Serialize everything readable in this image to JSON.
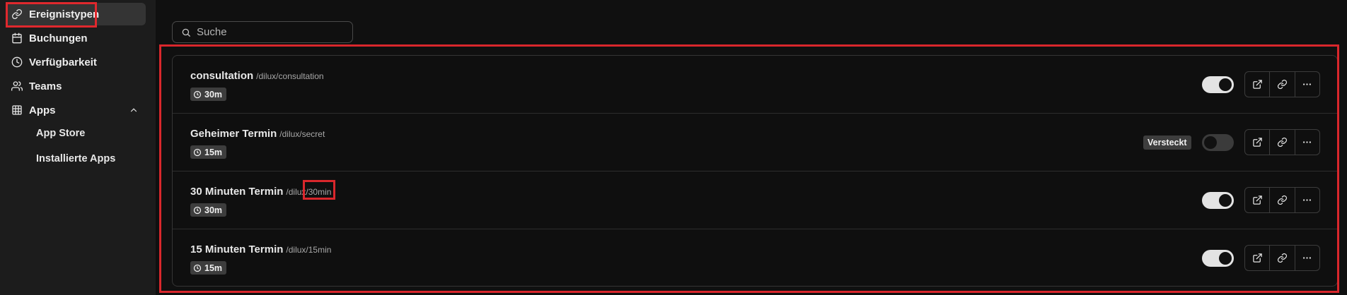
{
  "sidebar": {
    "items": [
      {
        "label": "Ereignistypen",
        "icon": "link-icon",
        "active": true
      },
      {
        "label": "Buchungen",
        "icon": "calendar-icon"
      },
      {
        "label": "Verfügbarkeit",
        "icon": "clock-icon"
      },
      {
        "label": "Teams",
        "icon": "users-icon"
      },
      {
        "label": "Apps",
        "icon": "grid-icon"
      }
    ],
    "apps_sub": [
      {
        "label": "App Store"
      },
      {
        "label": "Installierte Apps"
      }
    ]
  },
  "search": {
    "placeholder": "Suche"
  },
  "event_types": [
    {
      "title": "consultation",
      "slug": "/dilux/consultation",
      "duration": "30m",
      "enabled": true,
      "hidden_label": ""
    },
    {
      "title": "Geheimer Termin",
      "slug": "/dilux/secret",
      "duration": "15m",
      "enabled": false,
      "hidden_label": "Versteckt"
    },
    {
      "title": "30 Minuten Termin",
      "slug": "/dilux/30min",
      "duration": "30m",
      "enabled": true,
      "hidden_label": ""
    },
    {
      "title": "15 Minuten Termin",
      "slug": "/dilux/15min",
      "duration": "15m",
      "enabled": true,
      "hidden_label": ""
    }
  ],
  "colors": {
    "highlight": "#d9272c",
    "background": "#101010",
    "sidebar": "#1c1c1c"
  }
}
